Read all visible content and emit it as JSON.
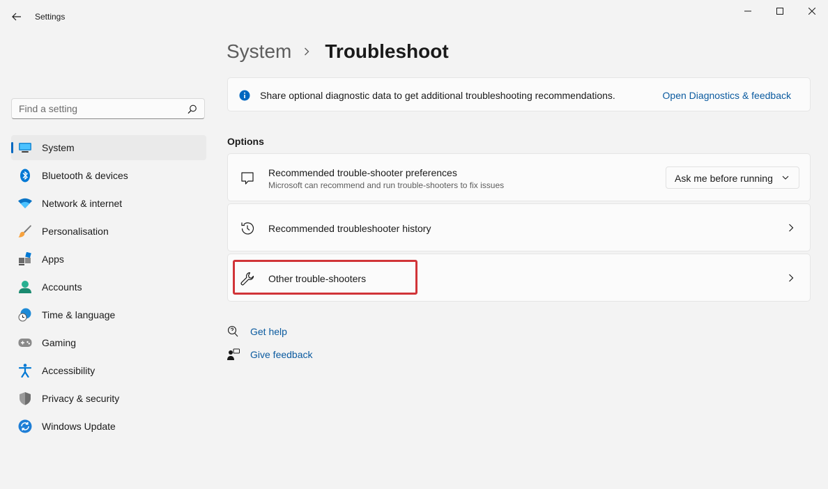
{
  "window": {
    "title": "Settings",
    "controls": {
      "minimize": "minimize",
      "maximize": "maximize",
      "close": "close"
    }
  },
  "search": {
    "placeholder": "Find a setting",
    "value": ""
  },
  "sidebar": {
    "selected_index": 0,
    "accent_color": "#0067c0",
    "items": [
      {
        "label": "System",
        "icon": "system-monitor-icon"
      },
      {
        "label": "Bluetooth & devices",
        "icon": "bluetooth-icon"
      },
      {
        "label": "Network & internet",
        "icon": "wifi-icon"
      },
      {
        "label": "Personalisation",
        "icon": "paintbrush-icon"
      },
      {
        "label": "Apps",
        "icon": "apps-icon"
      },
      {
        "label": "Accounts",
        "icon": "accounts-icon"
      },
      {
        "label": "Time & language",
        "icon": "globe-clock-icon"
      },
      {
        "label": "Gaming",
        "icon": "gamepad-icon"
      },
      {
        "label": "Accessibility",
        "icon": "accessibility-icon"
      },
      {
        "label": "Privacy & security",
        "icon": "shield-icon"
      },
      {
        "label": "Windows Update",
        "icon": "update-icon"
      }
    ]
  },
  "breadcrumb": {
    "parent": "System",
    "current": "Troubleshoot"
  },
  "banner": {
    "text": "Share optional diagnostic data to get additional troubleshooting recommendations.",
    "link": "Open Diagnostics & feedback"
  },
  "options": {
    "title": "Options",
    "preferences": {
      "title": "Recommended trouble-shooter preferences",
      "subtitle": "Microsoft can recommend and run trouble-shooters to fix issues",
      "dropdown_value": "Ask me before running"
    },
    "history": {
      "title": "Recommended troubleshooter history"
    },
    "other": {
      "title": "Other trouble-shooters",
      "highlight_color": "#d13438"
    }
  },
  "help": {
    "get_help": "Get help",
    "give_feedback": "Give feedback"
  },
  "colors": {
    "link": "#0a5a9f",
    "info": "#0067c0"
  }
}
